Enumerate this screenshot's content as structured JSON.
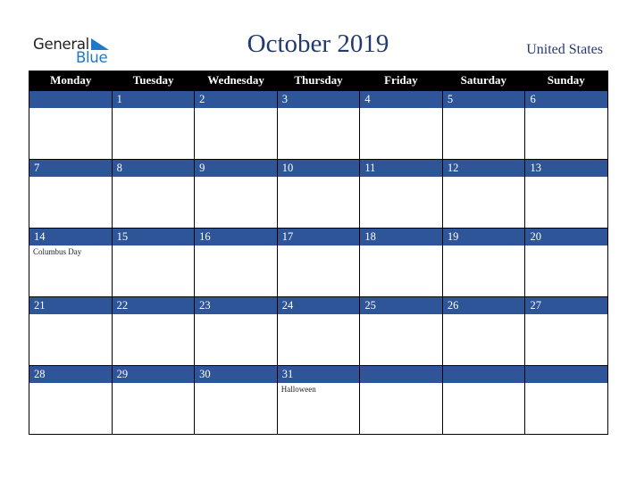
{
  "logo": {
    "general": "General",
    "blue": "Blue"
  },
  "header": {
    "title": "October 2019",
    "country": "United States"
  },
  "weekdays": [
    "Monday",
    "Tuesday",
    "Wednesday",
    "Thursday",
    "Friday",
    "Saturday",
    "Sunday"
  ],
  "weeks": [
    {
      "days": [
        "",
        "1",
        "2",
        "3",
        "4",
        "5",
        "6"
      ],
      "events": [
        "",
        "",
        "",
        "",
        "",
        "",
        ""
      ]
    },
    {
      "days": [
        "7",
        "8",
        "9",
        "10",
        "11",
        "12",
        "13"
      ],
      "events": [
        "",
        "",
        "",
        "",
        "",
        "",
        ""
      ]
    },
    {
      "days": [
        "14",
        "15",
        "16",
        "17",
        "18",
        "19",
        "20"
      ],
      "events": [
        "Columbus Day",
        "",
        "",
        "",
        "",
        "",
        ""
      ]
    },
    {
      "days": [
        "21",
        "22",
        "23",
        "24",
        "25",
        "26",
        "27"
      ],
      "events": [
        "",
        "",
        "",
        "",
        "",
        "",
        ""
      ]
    },
    {
      "days": [
        "28",
        "29",
        "30",
        "31",
        "",
        "",
        ""
      ],
      "events": [
        "",
        "",
        "",
        "Halloween",
        "",
        "",
        ""
      ]
    }
  ],
  "colors": {
    "header_bg": "#000000",
    "week_bar": "#2e5597",
    "title": "#223a6e",
    "logo_blue": "#1d7ac9"
  }
}
